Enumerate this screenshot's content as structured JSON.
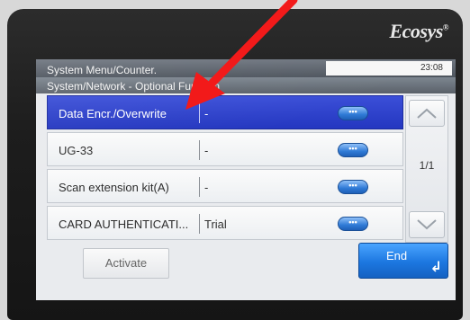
{
  "brand": {
    "name": "Ecosys",
    "mark": "®"
  },
  "header": {
    "path": "System Menu/Counter.",
    "subpath": "System/Network - Optional Function",
    "time": "23:08"
  },
  "functions": [
    {
      "name": "Data Encr./Overwrite",
      "value": "-",
      "more": "•••",
      "selected": true
    },
    {
      "name": "UG-33",
      "value": "-",
      "more": "•••",
      "selected": false
    },
    {
      "name": "Scan extension kit(A)",
      "value": "-",
      "more": "•••",
      "selected": false
    },
    {
      "name": "CARD AUTHENTICATI...",
      "value": "Trial",
      "more": "•••",
      "selected": false
    }
  ],
  "pager": {
    "page": "1/1",
    "up_icon": "chevron-up-icon",
    "down_icon": "chevron-down-icon"
  },
  "buttons": {
    "activate": "Activate",
    "end": "End",
    "end_icon": "return-arrow-icon"
  },
  "colors": {
    "selected_row": "#2437c0",
    "end_button": "#1c77e0",
    "annotation_arrow": "#f21a1a"
  }
}
